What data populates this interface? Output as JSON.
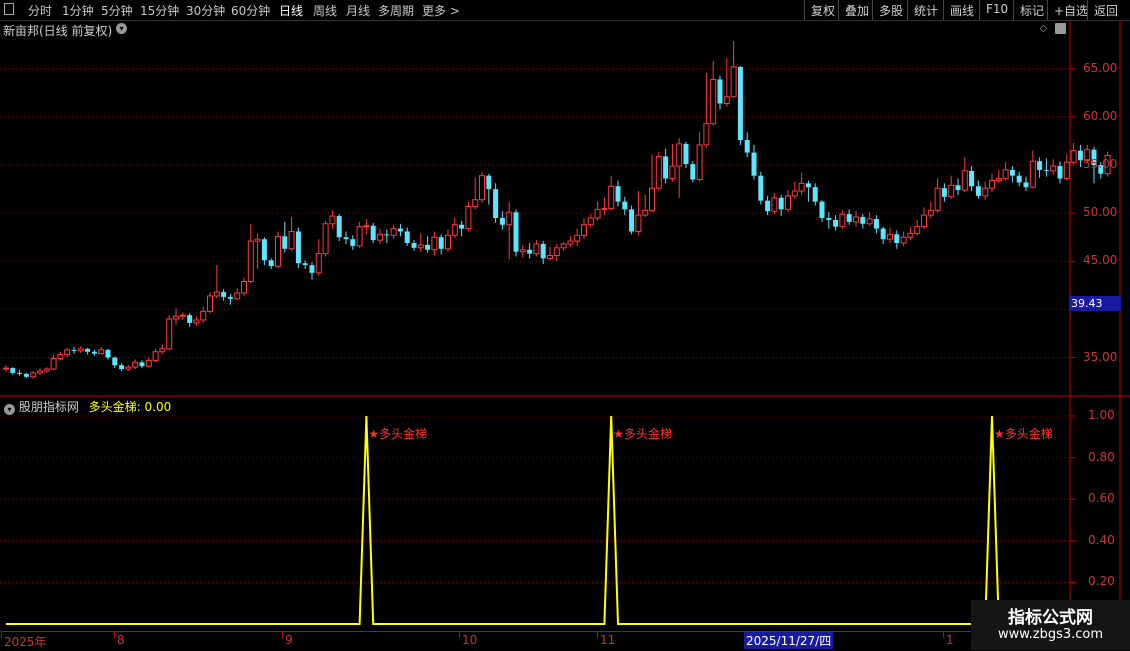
{
  "toolbar": {
    "left_items": [
      "分时",
      "1分钟",
      "5分钟",
      "15分钟",
      "30分钟",
      "60分钟",
      "日线",
      "周线",
      "月线",
      "多周期",
      "更多 >"
    ],
    "active_item": "日线",
    "right_items": [
      "复权",
      "叠加",
      "多股",
      "统计",
      "画线",
      "F10",
      "标记",
      "+自选",
      "返回"
    ]
  },
  "main_chart": {
    "title": "新亩邦(日线 前复权)",
    "price_labels": [
      "65.00",
      "60.00",
      "55.00",
      "50.00",
      "45.00",
      "35.00"
    ],
    "current_price_badge": "39.43",
    "colors": {
      "up": "#ff3b3b",
      "down": "#5ce6ff",
      "grid": "#8b0000"
    }
  },
  "indicator": {
    "name": "股朋指标网",
    "value_label": "多头金梯: 0.00",
    "axis_labels": [
      "1.00",
      "0.80",
      "0.60",
      "0.40",
      "0.20"
    ],
    "signal_text": "★多头金梯",
    "line_color": "#ffff00"
  },
  "date_axis": {
    "ticks": [
      "2025年",
      "8",
      "9",
      "10",
      "11",
      "1"
    ],
    "highlight": "2025/11/27/四"
  },
  "watermark": {
    "line1": "指标公式网",
    "line2": "www.zbgs3.com"
  },
  "chart_data": {
    "type": "candlestick",
    "ylim": [
      31,
      68
    ],
    "candles": [
      [
        33.8,
        33.9,
        34.2,
        33.5
      ],
      [
        33.9,
        33.4,
        34.0,
        33.2
      ],
      [
        33.4,
        33.3,
        33.7,
        33.1
      ],
      [
        33.3,
        33.0,
        33.4,
        32.9
      ],
      [
        33.0,
        33.4,
        33.6,
        32.8
      ],
      [
        33.4,
        33.6,
        33.9,
        33.2
      ],
      [
        33.6,
        33.8,
        34.0,
        33.4
      ],
      [
        33.8,
        34.9,
        35.3,
        33.7
      ],
      [
        34.9,
        35.3,
        35.6,
        34.7
      ],
      [
        35.3,
        35.8,
        36.0,
        35.0
      ],
      [
        35.8,
        35.7,
        36.1,
        35.4
      ],
      [
        35.7,
        35.9,
        36.2,
        35.5
      ],
      [
        35.9,
        35.6,
        36.0,
        35.3
      ],
      [
        35.6,
        35.4,
        35.8,
        35.2
      ],
      [
        35.4,
        35.8,
        36.1,
        35.3
      ],
      [
        35.8,
        35.0,
        35.9,
        34.8
      ],
      [
        35.0,
        34.2,
        35.1,
        33.9
      ],
      [
        34.2,
        33.8,
        34.4,
        33.6
      ],
      [
        33.8,
        34.0,
        34.2,
        33.6
      ],
      [
        34.0,
        34.5,
        34.8,
        33.8
      ],
      [
        34.5,
        34.1,
        34.7,
        33.9
      ],
      [
        34.1,
        34.7,
        35.0,
        34.0
      ],
      [
        34.7,
        35.6,
        35.9,
        34.5
      ],
      [
        35.6,
        35.9,
        36.3,
        35.4
      ],
      [
        35.9,
        39.0,
        39.4,
        35.8
      ],
      [
        39.0,
        39.3,
        40.1,
        38.4
      ],
      [
        39.3,
        39.4,
        39.7,
        38.9
      ],
      [
        39.4,
        38.6,
        39.6,
        38.2
      ],
      [
        38.6,
        38.9,
        39.3,
        38.3
      ],
      [
        38.9,
        39.8,
        40.3,
        38.6
      ],
      [
        39.8,
        41.4,
        41.8,
        39.6
      ],
      [
        41.4,
        41.8,
        44.6,
        41.2
      ],
      [
        41.8,
        41.3,
        42.1,
        40.9
      ],
      [
        41.3,
        41.1,
        41.6,
        40.5
      ],
      [
        41.1,
        41.7,
        42.2,
        41.0
      ],
      [
        41.7,
        42.9,
        43.3,
        41.4
      ],
      [
        42.9,
        47.1,
        48.9,
        42.7
      ],
      [
        47.1,
        47.3,
        47.9,
        44.2
      ],
      [
        47.3,
        45.1,
        47.5,
        44.6
      ],
      [
        45.1,
        44.5,
        45.3,
        44.2
      ],
      [
        44.5,
        47.6,
        48.1,
        44.3
      ],
      [
        47.6,
        46.3,
        49.1,
        45.9
      ],
      [
        46.3,
        48.1,
        49.6,
        46.1
      ],
      [
        48.1,
        44.8,
        48.5,
        44.3
      ],
      [
        44.8,
        44.6,
        45.1,
        44.2
      ],
      [
        44.6,
        43.8,
        44.9,
        43.1
      ],
      [
        43.8,
        45.8,
        47.3,
        43.5
      ],
      [
        45.8,
        48.9,
        49.2,
        45.5
      ],
      [
        48.9,
        49.7,
        50.3,
        48.4
      ],
      [
        49.7,
        47.5,
        49.9,
        47.1
      ],
      [
        47.5,
        47.3,
        48.1,
        46.8
      ],
      [
        47.3,
        46.6,
        47.7,
        46.2
      ],
      [
        46.6,
        48.6,
        49.1,
        46.4
      ],
      [
        48.6,
        48.7,
        49.4,
        47.8
      ],
      [
        48.7,
        47.2,
        49.0,
        46.9
      ],
      [
        47.2,
        47.8,
        48.4,
        46.8
      ],
      [
        47.8,
        47.7,
        48.3,
        46.9
      ],
      [
        47.7,
        48.4,
        48.8,
        47.3
      ],
      [
        48.4,
        48.1,
        48.9,
        47.6
      ],
      [
        48.1,
        46.9,
        48.5,
        46.6
      ],
      [
        46.9,
        46.4,
        47.2,
        46.1
      ],
      [
        46.4,
        46.7,
        47.9,
        46.0
      ],
      [
        46.7,
        46.2,
        47.6,
        45.9
      ],
      [
        46.2,
        47.5,
        48.1,
        45.6
      ],
      [
        47.5,
        46.3,
        47.8,
        45.7
      ],
      [
        46.3,
        47.7,
        48.3,
        46.0
      ],
      [
        47.7,
        48.8,
        49.5,
        47.4
      ],
      [
        48.8,
        48.4,
        49.2,
        47.6
      ],
      [
        48.4,
        50.7,
        51.2,
        48.1
      ],
      [
        50.7,
        51.4,
        53.7,
        50.4
      ],
      [
        51.4,
        53.9,
        54.3,
        51.1
      ],
      [
        53.9,
        52.5,
        54.1,
        50.9
      ],
      [
        52.5,
        49.5,
        53.1,
        49.0
      ],
      [
        49.5,
        48.8,
        50.2,
        48.3
      ],
      [
        48.8,
        50.1,
        51.2,
        45.2
      ],
      [
        50.1,
        46.0,
        50.4,
        45.5
      ],
      [
        46.0,
        46.2,
        46.7,
        45.4
      ],
      [
        46.2,
        45.8,
        46.9,
        45.3
      ],
      [
        45.8,
        46.8,
        47.2,
        45.5
      ],
      [
        46.8,
        45.3,
        47.1,
        44.7
      ],
      [
        45.3,
        45.6,
        46.5,
        45.1
      ],
      [
        45.6,
        46.4,
        46.8,
        45.0
      ],
      [
        46.4,
        46.8,
        47.0,
        46.1
      ],
      [
        46.8,
        47.1,
        47.6,
        46.5
      ],
      [
        47.1,
        47.7,
        48.4,
        46.6
      ],
      [
        47.7,
        48.8,
        49.5,
        47.3
      ],
      [
        48.8,
        49.5,
        49.9,
        48.5
      ],
      [
        49.5,
        50.4,
        51.2,
        49.2
      ],
      [
        50.4,
        50.5,
        51.6,
        49.8
      ],
      [
        50.5,
        52.8,
        53.9,
        50.3
      ],
      [
        52.8,
        51.2,
        53.4,
        50.7
      ],
      [
        51.2,
        50.4,
        51.7,
        49.8
      ],
      [
        50.4,
        48.1,
        50.8,
        47.8
      ],
      [
        48.1,
        49.8,
        52.3,
        47.7
      ],
      [
        49.8,
        50.3,
        51.9,
        49.6
      ],
      [
        50.3,
        52.6,
        56.1,
        50.1
      ],
      [
        52.6,
        55.9,
        56.4,
        52.3
      ],
      [
        55.9,
        53.6,
        56.7,
        53.1
      ],
      [
        53.6,
        54.9,
        57.2,
        53.3
      ],
      [
        54.9,
        57.2,
        57.8,
        51.6
      ],
      [
        57.2,
        55.1,
        57.4,
        54.7
      ],
      [
        55.1,
        53.5,
        55.4,
        53.2
      ],
      [
        53.5,
        57.1,
        58.4,
        53.3
      ],
      [
        57.1,
        59.3,
        64.6,
        56.8
      ],
      [
        59.3,
        63.9,
        65.8,
        59.1
      ],
      [
        63.9,
        61.4,
        64.3,
        60.8
      ],
      [
        61.4,
        62.1,
        66.1,
        61.1
      ],
      [
        62.1,
        65.2,
        67.9,
        62.0
      ],
      [
        65.2,
        57.6,
        65.3,
        57.1
      ],
      [
        57.6,
        56.3,
        58.4,
        55.8
      ],
      [
        56.3,
        53.9,
        57.1,
        53.5
      ],
      [
        53.9,
        51.3,
        54.3,
        50.9
      ],
      [
        51.3,
        50.2,
        51.8,
        49.8
      ],
      [
        50.2,
        51.6,
        52.1,
        49.9
      ],
      [
        51.6,
        50.4,
        51.9,
        49.7
      ],
      [
        50.4,
        51.8,
        52.4,
        50.1
      ],
      [
        51.8,
        52.3,
        53.3,
        51.5
      ],
      [
        52.3,
        53.1,
        54.2,
        51.9
      ],
      [
        53.1,
        52.7,
        53.4,
        51.2
      ],
      [
        52.7,
        51.2,
        53.1,
        50.8
      ],
      [
        51.2,
        49.5,
        51.4,
        49.1
      ],
      [
        49.5,
        49.3,
        50.1,
        48.4
      ],
      [
        49.3,
        48.6,
        49.8,
        48.2
      ],
      [
        48.6,
        49.9,
        50.3,
        48.4
      ],
      [
        49.9,
        49.1,
        50.4,
        48.8
      ],
      [
        49.1,
        49.6,
        50.2,
        48.6
      ],
      [
        49.6,
        48.9,
        49.9,
        48.4
      ],
      [
        48.9,
        49.4,
        50.1,
        48.7
      ],
      [
        49.4,
        48.4,
        49.8,
        47.9
      ],
      [
        48.4,
        47.3,
        48.6,
        46.8
      ],
      [
        47.3,
        47.8,
        48.5,
        46.9
      ],
      [
        47.8,
        46.9,
        48.2,
        46.3
      ],
      [
        46.9,
        47.5,
        48.1,
        46.6
      ],
      [
        47.5,
        47.9,
        48.6,
        47.2
      ],
      [
        47.9,
        48.6,
        49.3,
        47.7
      ],
      [
        48.6,
        49.8,
        50.6,
        48.3
      ],
      [
        49.8,
        50.3,
        51.2,
        49.5
      ],
      [
        50.3,
        52.6,
        53.6,
        50.1
      ],
      [
        52.6,
        51.7,
        53.1,
        51.2
      ],
      [
        51.7,
        52.9,
        53.9,
        51.5
      ],
      [
        52.9,
        52.4,
        53.6,
        51.9
      ],
      [
        52.4,
        54.4,
        55.8,
        52.2
      ],
      [
        54.4,
        52.8,
        54.9,
        52.3
      ],
      [
        52.8,
        51.8,
        53.4,
        51.5
      ],
      [
        51.8,
        52.6,
        53.3,
        51.4
      ],
      [
        52.6,
        53.4,
        54.1,
        52.2
      ],
      [
        53.4,
        53.6,
        54.5,
        53.1
      ],
      [
        53.6,
        54.5,
        55.3,
        53.4
      ],
      [
        54.5,
        53.9,
        54.9,
        53.2
      ],
      [
        53.9,
        53.2,
        54.3,
        52.8
      ],
      [
        53.2,
        52.7,
        53.8,
        52.3
      ],
      [
        52.7,
        55.4,
        56.5,
        52.6
      ],
      [
        55.4,
        54.5,
        55.8,
        53.7
      ],
      [
        54.5,
        54.4,
        55.7,
        53.8
      ],
      [
        54.4,
        54.9,
        55.6,
        54.0
      ],
      [
        54.9,
        53.6,
        55.4,
        53.1
      ],
      [
        53.6,
        55.3,
        56.1,
        53.4
      ],
      [
        55.3,
        56.5,
        57.3,
        55.1
      ],
      [
        56.5,
        55.5,
        57.1,
        54.8
      ],
      [
        55.5,
        56.6,
        57.1,
        55.2
      ],
      [
        56.6,
        55.0,
        56.9,
        53.1
      ],
      [
        55.0,
        54.1,
        55.3,
        53.6
      ],
      [
        54.1,
        56.0,
        56.4,
        53.8
      ]
    ],
    "indicator_values": {
      "total": 155,
      "spikes_at": [
        53,
        89,
        145
      ]
    }
  }
}
